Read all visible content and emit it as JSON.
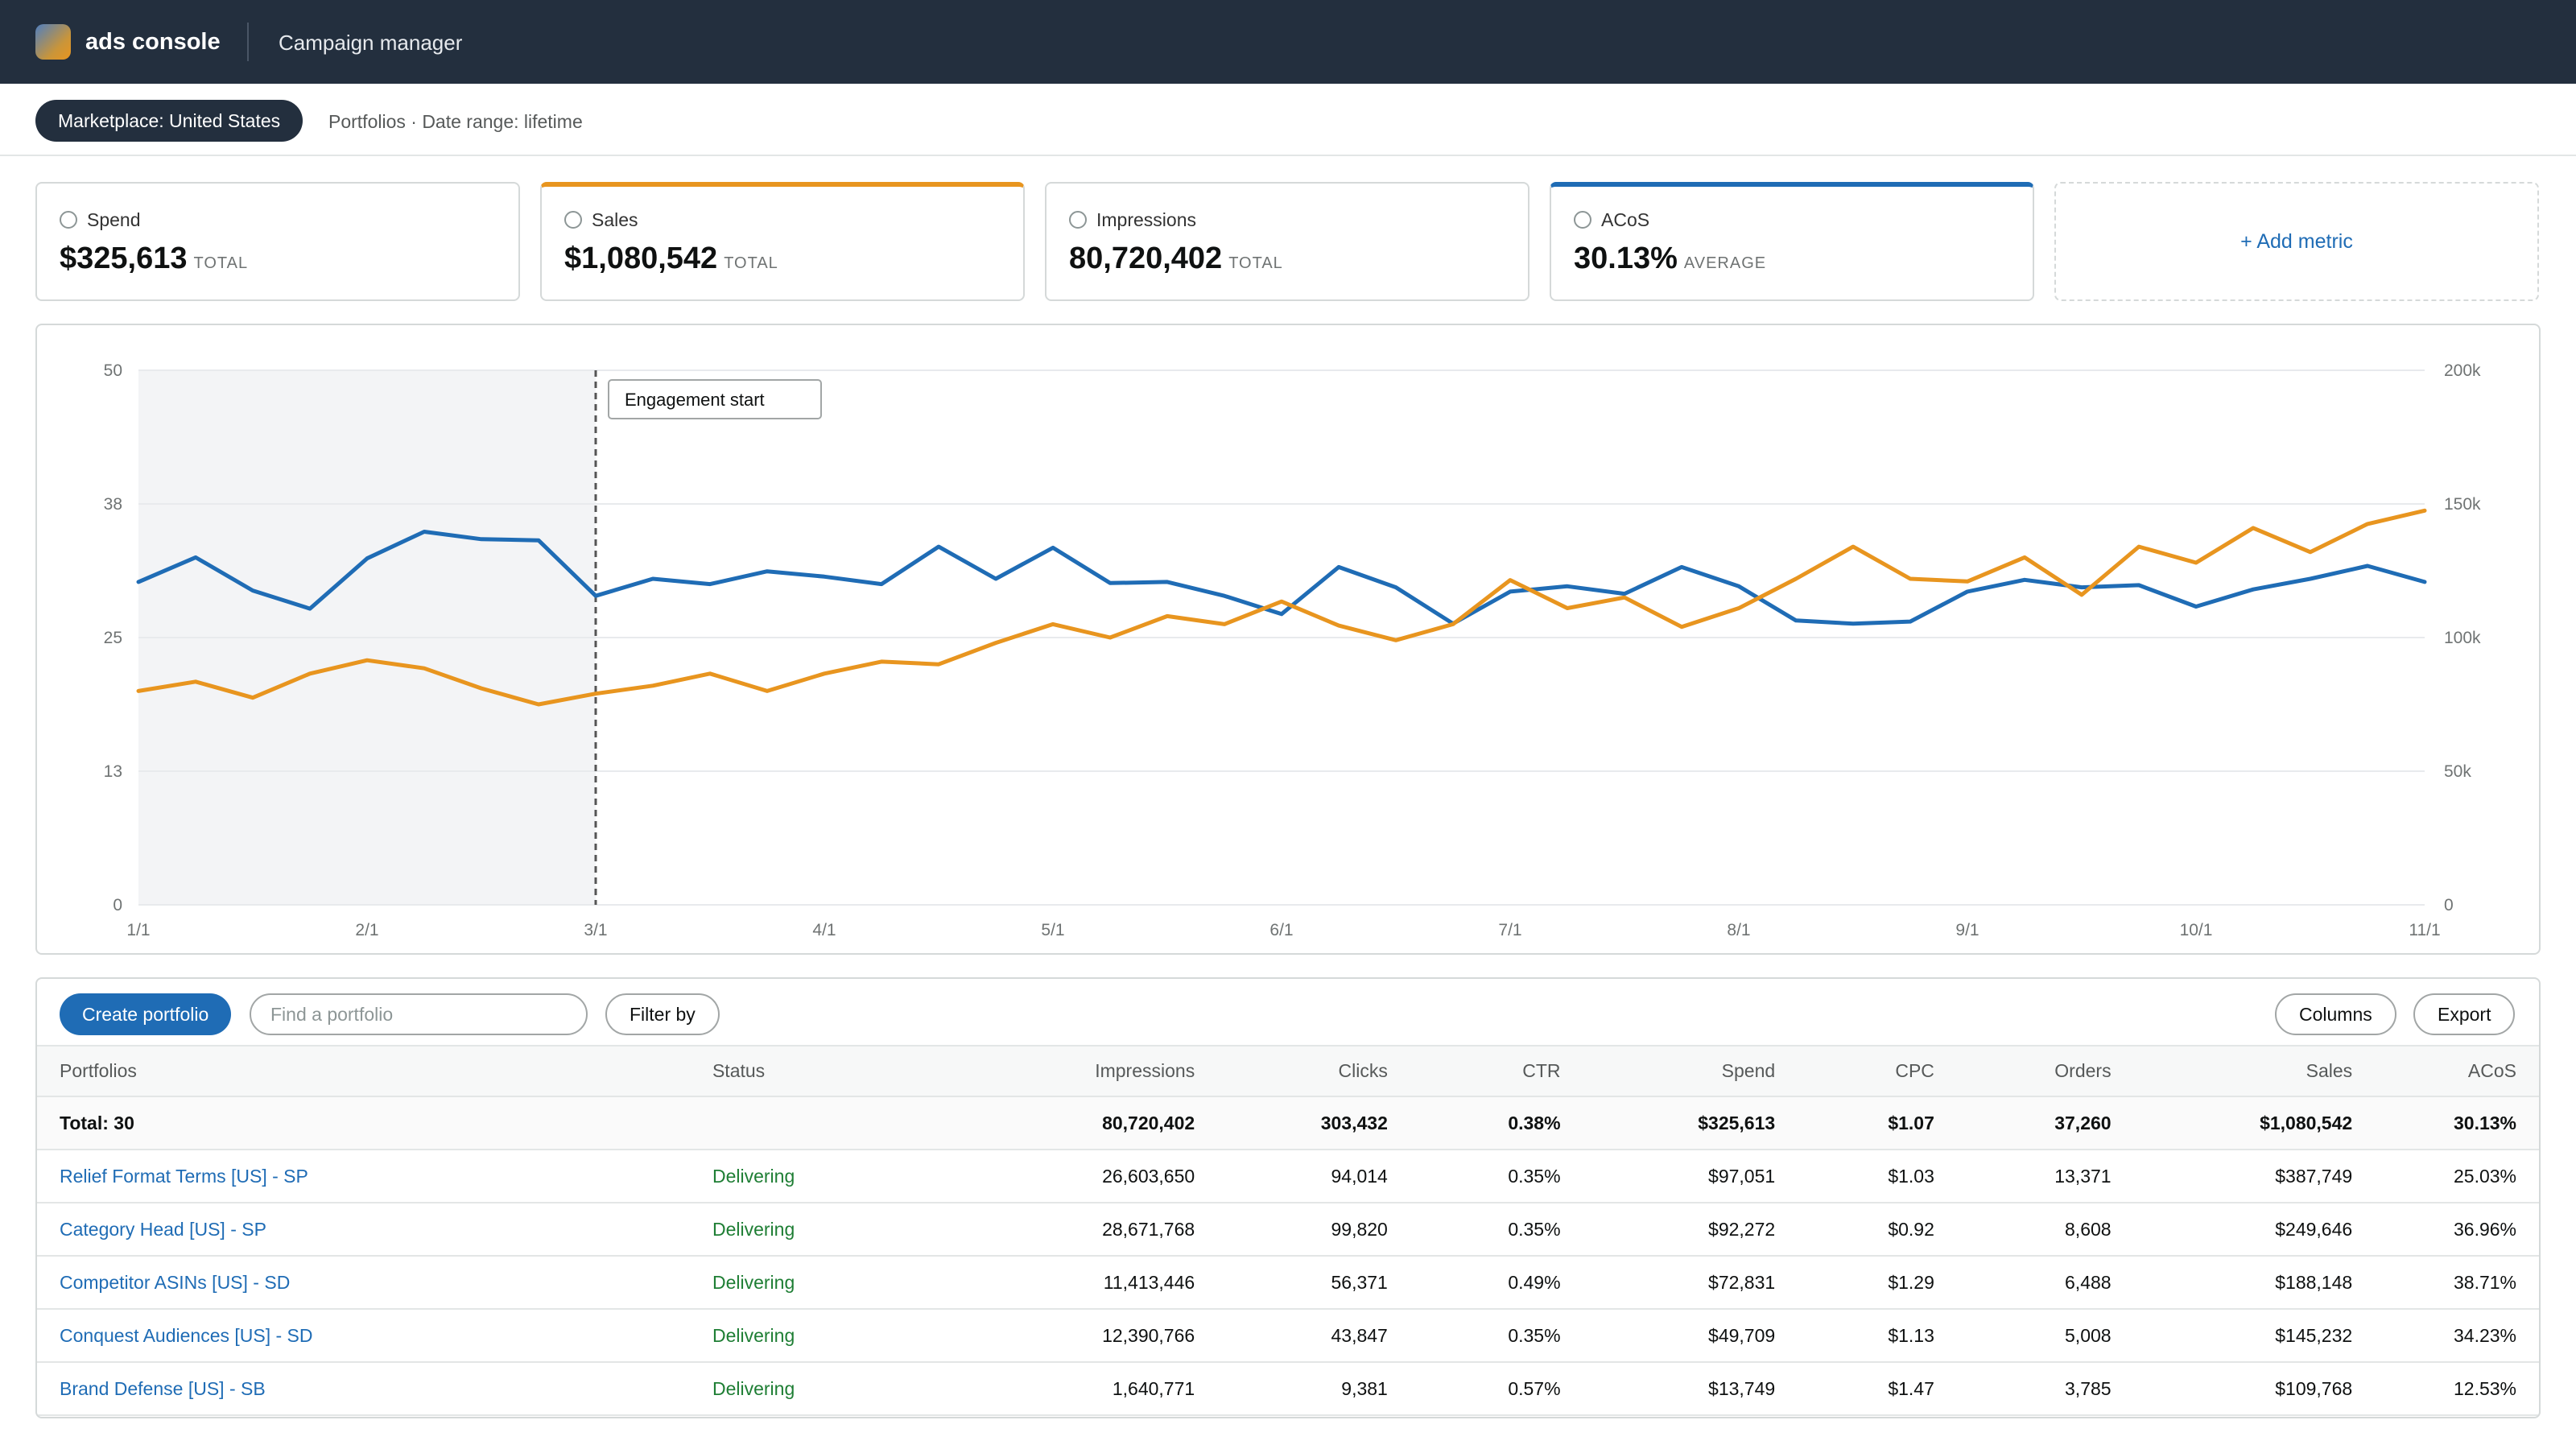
{
  "header": {
    "app_name": "ads console",
    "page_name": "Campaign manager"
  },
  "subheader": {
    "marketplace_pill": "Marketplace: United States",
    "info": "Portfolios · Date range: lifetime"
  },
  "metrics": [
    {
      "label": "Spend",
      "value": "$325,613",
      "suffix": "TOTAL",
      "selected_color": ""
    },
    {
      "label": "Sales",
      "value": "$1,080,542",
      "suffix": "TOTAL",
      "selected_color": "#e8951f"
    },
    {
      "label": "Impressions",
      "value": "80,720,402",
      "suffix": "TOTAL",
      "selected_color": ""
    },
    {
      "label": "ACoS",
      "value": "30.13%",
      "suffix": "AVERAGE",
      "selected_color": "#1f6cb5"
    }
  ],
  "add_metric_label": "+ Add metric",
  "chart_data": {
    "type": "line",
    "x_tick_labels": [
      "1/1",
      "2/1",
      "3/1",
      "4/1",
      "5/1",
      "6/1",
      "7/1",
      "8/1",
      "9/1",
      "10/1",
      "11/1"
    ],
    "y_left_ticks": [
      "0",
      "13",
      "25",
      "38",
      "50"
    ],
    "y_left_range": [
      0,
      50
    ],
    "y_right_ticks": [
      "0",
      "50k",
      "100k",
      "150k",
      "200k"
    ],
    "y_right_range": [
      0,
      200000
    ],
    "grid": true,
    "annotation": {
      "label": "Engagement start",
      "x_index": 8
    },
    "shaded_range_before_index": 8,
    "series": [
      {
        "color": "#1f6cb5",
        "axis": "left",
        "values": [
          30.2,
          32.5,
          29.4,
          27.7,
          32.4,
          34.9,
          34.2,
          34.1,
          28.9,
          30.5,
          30.0,
          31.2,
          30.7,
          30.0,
          33.5,
          30.5,
          33.4,
          30.1,
          30.2,
          28.9,
          27.2,
          31.6,
          29.7,
          26.3,
          29.3,
          29.8,
          29.1,
          31.6,
          29.8,
          26.6,
          26.3,
          26.5,
          29.3,
          30.4,
          29.7,
          29.9,
          27.9,
          29.5,
          30.5,
          31.7,
          30.2
        ]
      },
      {
        "color": "#e8951f",
        "axis": "right",
        "values": [
          80000,
          83500,
          77500,
          86500,
          91500,
          88500,
          81000,
          75000,
          79000,
          82000,
          86500,
          80000,
          86500,
          91000,
          90000,
          98000,
          105000,
          100000,
          108000,
          105000,
          113500,
          104500,
          99000,
          105000,
          121500,
          111000,
          115000,
          104000,
          111000,
          122000,
          134000,
          122000,
          121000,
          130000,
          116000,
          134000,
          128000,
          141000,
          132000,
          142500,
          147500
        ]
      }
    ]
  },
  "table": {
    "create_button": "Create portfolio",
    "search_placeholder": "Find a portfolio",
    "filter_button": "Filter by",
    "columns_button": "Columns",
    "export_button": "Export",
    "headers": [
      "Portfolios",
      "Status",
      "Impressions",
      "Clicks",
      "CTR",
      "Spend",
      "CPC",
      "Orders",
      "Sales",
      "ACoS"
    ],
    "total_row": [
      "Total: 30",
      "",
      "80,720,402",
      "303,432",
      "0.38%",
      "$325,613",
      "$1.07",
      "37,260",
      "$1,080,542",
      "30.13%"
    ],
    "rows": [
      [
        "Relief Format Terms [US] - SP",
        "Delivering",
        "26,603,650",
        "94,014",
        "0.35%",
        "$97,051",
        "$1.03",
        "13,371",
        "$387,749",
        "25.03%"
      ],
      [
        "Category Head [US] - SP",
        "Delivering",
        "28,671,768",
        "99,820",
        "0.35%",
        "$92,272",
        "$0.92",
        "8,608",
        "$249,646",
        "36.96%"
      ],
      [
        "Competitor ASINs [US] - SD",
        "Delivering",
        "11,413,446",
        "56,371",
        "0.49%",
        "$72,831",
        "$1.29",
        "6,488",
        "$188,148",
        "38.71%"
      ],
      [
        "Conquest Audiences [US] - SD",
        "Delivering",
        "12,390,766",
        "43,847",
        "0.35%",
        "$49,709",
        "$1.13",
        "5,008",
        "$145,232",
        "34.23%"
      ],
      [
        "Brand Defense [US] - SB",
        "Delivering",
        "1,640,771",
        "9,381",
        "0.57%",
        "$13,749",
        "$1.47",
        "3,785",
        "$109,768",
        "12.53%"
      ]
    ]
  }
}
